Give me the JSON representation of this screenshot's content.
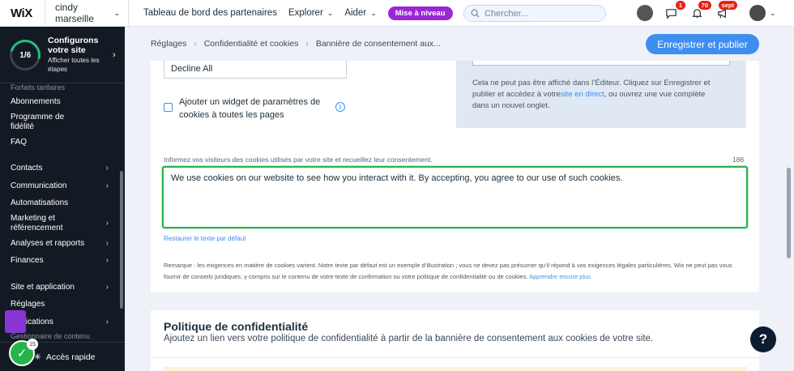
{
  "topbar": {
    "logo": "WiX",
    "site_name": "cindy marseille",
    "nav": [
      "Tableau de bord des partenaires",
      "Explorer",
      "Aider"
    ],
    "upgrade_label": "Mise à niveau",
    "search_placeholder": "Chercher...",
    "badges": {
      "messages": "1",
      "notifications": "70",
      "updates": "sept"
    }
  },
  "sidebar": {
    "setup_progress": "1/6",
    "setup_title": "Configurons votre site",
    "setup_sub": "Afficher toutes les étapes",
    "faded_top": "Forfaits tarifaires",
    "items_a": [
      {
        "label": "Abonnements",
        "arrow": false
      },
      {
        "label": "Programme de fidélité",
        "arrow": false
      },
      {
        "label": "FAQ",
        "arrow": false
      }
    ],
    "items_b": [
      {
        "label": "Contacts",
        "arrow": true
      },
      {
        "label": "Communication",
        "arrow": true
      },
      {
        "label": "Automatisations",
        "arrow": false
      },
      {
        "label": "Marketing et référencement",
        "arrow": true
      },
      {
        "label": "Analyses et rapports",
        "arrow": true
      },
      {
        "label": "Finances",
        "arrow": true
      }
    ],
    "items_c": [
      {
        "label": "Site et application",
        "arrow": true
      },
      {
        "label": "Réglages",
        "arrow": false
      },
      {
        "label": "applications",
        "arrow": true
      }
    ],
    "faded_bottom": "Gestionnaire de contenu",
    "quick_access": "Accès rapide",
    "check_badge": "15"
  },
  "header": {
    "breadcrumbs": [
      "Réglages",
      "Confidentialité et cookies",
      "Bannière de consentement aux..."
    ],
    "publish_label": "Enregistrer et publier"
  },
  "content": {
    "decline_value": "Decline All",
    "widget_checkbox_label": "Ajouter un widget de paramètres de cookies à toutes les pages",
    "preview_text_1": "Cela ne peut pas être affiché dans l’Éditeur. Cliquez sur Enregistrer et publier et accédez à votre",
    "preview_link": "site en direct",
    "preview_text_2": ", ou ouvrez une vue complète dans un nouvel onglet.",
    "message_label": "Informez vos visiteurs des cookies utilisés par votre site et recueillez leur consentement.",
    "char_count": "186",
    "message_value": "We use cookies on our website to see how you interact with it. By accepting, you agree to our use of such cookies.",
    "restore_label": "Restaurer le texte par défaut",
    "remark": "Remarque : les exigences en matière de cookies varient. Notre texte par défaut est un exemple d’illustration ; vous ne devez pas présumer qu’il répond à vos exigences légales particulières. Wix ne peut pas vous fournir de conseils juridiques, y compris sur le contenu de votre texte de confirmation ou votre politique de confidentialité ou de cookies.",
    "learn_more": "Apprendre encore plus"
  },
  "privacy": {
    "title": "Politique de confidentialité",
    "subtitle": "Ajoutez un lien vers votre politique de confidentialité à partir de la bannière de consentement aux cookies de votre site."
  },
  "colors": {
    "accent": "#3e8ef0",
    "sidebar_bg": "#141a24",
    "focus_green": "#25b34a",
    "upgrade_purple": "#9a27d5"
  }
}
